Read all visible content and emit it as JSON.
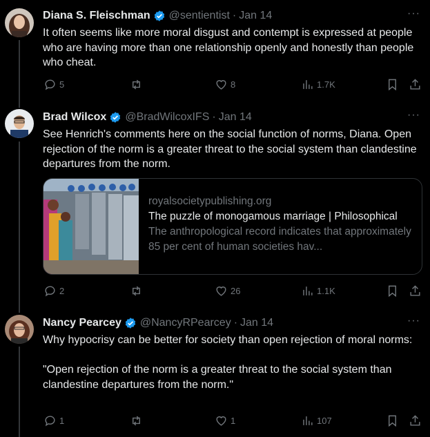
{
  "tweets": [
    {
      "name": "Diana S. Fleischman",
      "handle": "@sentientist",
      "separator": "·",
      "date": "Jan 14",
      "more": "···",
      "text": "It often seems like more moral disgust and contempt is expressed at people who are having more than one relationship openly and honestly than people who cheat.",
      "replies": "5",
      "retweets": "",
      "likes": "8",
      "views": "1.7K"
    },
    {
      "name": "Brad Wilcox",
      "handle": "@BradWilcoxIFS",
      "separator": "·",
      "date": "Jan 14",
      "more": "···",
      "text": "See Henrich's comments here on the social function of norms, Diana. Open rejection of the norm is a greater threat to the social system than clandestine departures from the norm.",
      "card": {
        "domain": "royalsocietypublishing.org",
        "title": "The puzzle of monogamous marriage | Philosophical",
        "description": "The anthropological record indicates that approximately 85 per cent of human societies hav..."
      },
      "replies": "2",
      "retweets": "",
      "likes": "26",
      "views": "1.1K"
    },
    {
      "name": "Nancy Pearcey",
      "handle": "@NancyRPearcey",
      "separator": "·",
      "date": "Jan 14",
      "more": "···",
      "text": "Why hypocrisy can be better for society than open rejection of moral norms:\n\n\"Open rejection of the norm is a greater threat to the social system than clandestine departures from the norm.\"",
      "replies": "1",
      "retweets": "",
      "likes": "1",
      "views": "107"
    }
  ],
  "colors": {
    "background": "#000000",
    "text": "#e7e9ea",
    "muted": "#71767b",
    "verified": "#1d9bf0",
    "border": "#2f3336"
  },
  "icons": [
    "reply-icon",
    "retweet-icon",
    "like-icon",
    "views-icon",
    "bookmark-icon",
    "share-icon",
    "verified-badge-icon",
    "more-icon"
  ]
}
